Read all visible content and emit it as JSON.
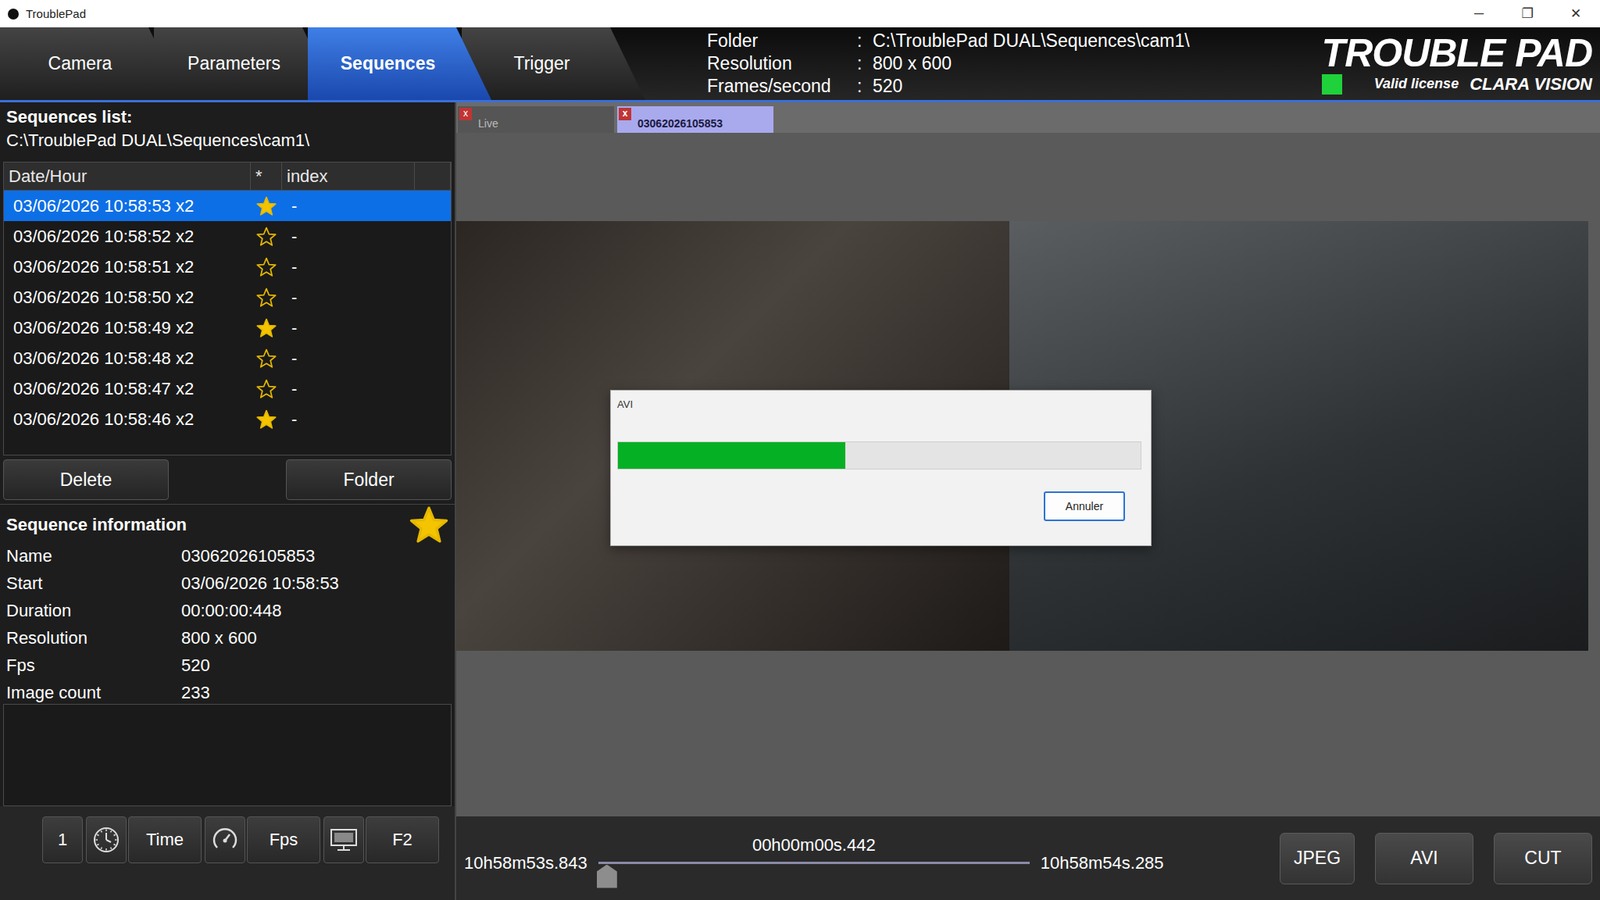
{
  "window": {
    "title": "TroublePad",
    "controls": [
      "─",
      "❐",
      "✕"
    ]
  },
  "tabs": [
    {
      "label": "Camera",
      "selected": false
    },
    {
      "label": "Parameters",
      "selected": false
    },
    {
      "label": "Sequences",
      "selected": true
    },
    {
      "label": "Trigger",
      "selected": false
    }
  ],
  "header_info": {
    "separator": ":",
    "fields": [
      {
        "label": "Folder",
        "value": "C:\\TroublePad DUAL\\Sequences\\cam1\\"
      },
      {
        "label": "Resolution",
        "value": "800 x 600"
      },
      {
        "label": "Frames/second",
        "value": "520"
      }
    ]
  },
  "logo": {
    "title": "TROUBLE PAD",
    "license": "Valid license",
    "brand": "CLARA VISION",
    "license_valid": true
  },
  "sequences": {
    "label": "Sequences list:",
    "path": "C:\\TroublePad DUAL\\Sequences\\cam1\\",
    "columns": [
      "Date/Hour",
      "*",
      "index"
    ],
    "rows": [
      {
        "date": "03/06/2026 10:58:53 x2",
        "starred": true,
        "index": "-",
        "selected": true
      },
      {
        "date": "03/06/2026 10:58:52 x2",
        "starred": false,
        "index": "-",
        "selected": false
      },
      {
        "date": "03/06/2026 10:58:51 x2",
        "starred": false,
        "index": "-",
        "selected": false
      },
      {
        "date": "03/06/2026 10:58:50 x2",
        "starred": false,
        "index": "-",
        "selected": false
      },
      {
        "date": "03/06/2026 10:58:49 x2",
        "starred": true,
        "index": "-",
        "selected": false
      },
      {
        "date": "03/06/2026 10:58:48 x2",
        "starred": false,
        "index": "-",
        "selected": false
      },
      {
        "date": "03/06/2026 10:58:47 x2",
        "starred": false,
        "index": "-",
        "selected": false
      },
      {
        "date": "03/06/2026 10:58:46 x2",
        "starred": true,
        "index": "-",
        "selected": false
      }
    ]
  },
  "list_buttons": [
    "Delete",
    "Folder"
  ],
  "info": {
    "title": "Sequence information",
    "starred": true,
    "fields": [
      {
        "label": "Name",
        "value": "03062026105853"
      },
      {
        "label": "Start",
        "value": "03/06/2026 10:58:53"
      },
      {
        "label": "Duration",
        "value": "00:00:00:448"
      },
      {
        "label": "Resolution",
        "value": "800 x 600"
      },
      {
        "label": "Fps",
        "value": "520"
      },
      {
        "label": "Image count",
        "value": "233"
      }
    ]
  },
  "toolbar": [
    {
      "label": "1",
      "kind": "text"
    },
    {
      "label": "Time",
      "kind": "clock"
    },
    {
      "label": "Fps",
      "kind": "gauge"
    },
    {
      "label": "F2",
      "kind": "monitor"
    }
  ],
  "viewer_tabs": [
    {
      "label": "Live",
      "close": "x",
      "selected": false
    },
    {
      "label": "03062026105853",
      "close": "x",
      "selected": true
    }
  ],
  "dialog": {
    "title": "AVI",
    "level": 0.435,
    "button": "Annuler"
  },
  "timeline": {
    "start": "10h58m53s.843",
    "duration": "00h00m00s.442",
    "end": "10h58m54s.285",
    "level": 0
  },
  "actions": [
    "JPEG",
    "AVI",
    "CUT"
  ]
}
